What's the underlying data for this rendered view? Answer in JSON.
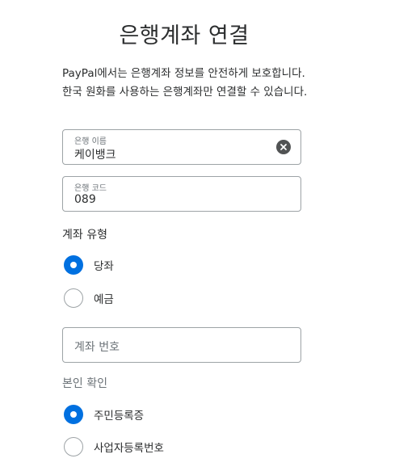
{
  "header": {
    "title": "은행계좌 연결"
  },
  "intro": {
    "text": "PayPal에서는 은행계좌 정보를 안전하게 보호합니다. 한국 원화를 사용하는 은행계좌만 연결할 수 있습니다."
  },
  "bank_name": {
    "label": "은행 이름",
    "value": "케이뱅크",
    "clear_icon": "clear-circle-x-icon"
  },
  "bank_code": {
    "label": "은행 코드",
    "value": "089"
  },
  "account_type": {
    "label": "계좌 유형",
    "options": [
      {
        "label": "당좌",
        "selected": true
      },
      {
        "label": "예금",
        "selected": false
      }
    ]
  },
  "account_number": {
    "placeholder": "계좌 번호"
  },
  "identity": {
    "label": "본인 확인",
    "options": [
      {
        "label": "주민등록증",
        "selected": true
      },
      {
        "label": "사업자등록번호",
        "selected": false
      }
    ]
  },
  "colors": {
    "accent": "#0070e0",
    "border": "#9da3a6",
    "text": "#2c2e2f",
    "muted": "#6c7378"
  }
}
